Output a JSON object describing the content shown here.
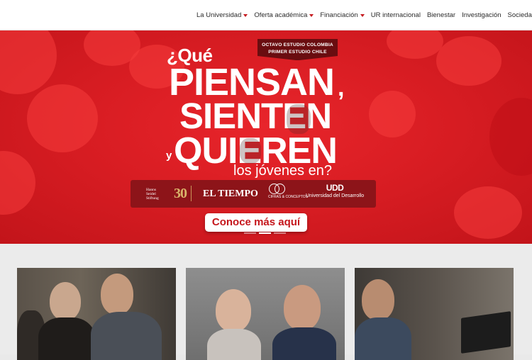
{
  "nav": {
    "items": [
      {
        "label": "La Universidad",
        "has_dropdown": true
      },
      {
        "label": "Oferta académica",
        "has_dropdown": true
      },
      {
        "label": "Financiación",
        "has_dropdown": true
      },
      {
        "label": "UR internacional",
        "has_dropdown": false
      },
      {
        "label": "Bienestar",
        "has_dropdown": false
      },
      {
        "label": "Investigación",
        "has_dropdown": false
      },
      {
        "label": "Sociedad y filantropía",
        "has_dropdown": false
      }
    ]
  },
  "hero": {
    "badge_line1": "OCTAVO ESTUDIO COLOMBIA",
    "badge_line2": "PRIMER ESTUDIO CHILE",
    "question_open": "¿Qué",
    "word1": "PIENSAN",
    "comma": ",",
    "word2": "SIENTEN",
    "conj": "y",
    "word3": "QUIEREN",
    "tail": "los jóvenes en?",
    "sponsors": {
      "hanns_line1": "Hanns",
      "hanns_line2": "Seidel",
      "hanns_line3": "Stiftung",
      "hanns_years": "30",
      "tiempo": "EL TIEMPO",
      "cc_text": "CIFRAS & CONCEPTOS",
      "udd_logo": "UDD",
      "udd_text": "Universidad del Desarrollo"
    },
    "cta_label": "Conoce más aquí",
    "slides_count": 3,
    "active_slide": 2,
    "primary_color": "#d91d23"
  }
}
